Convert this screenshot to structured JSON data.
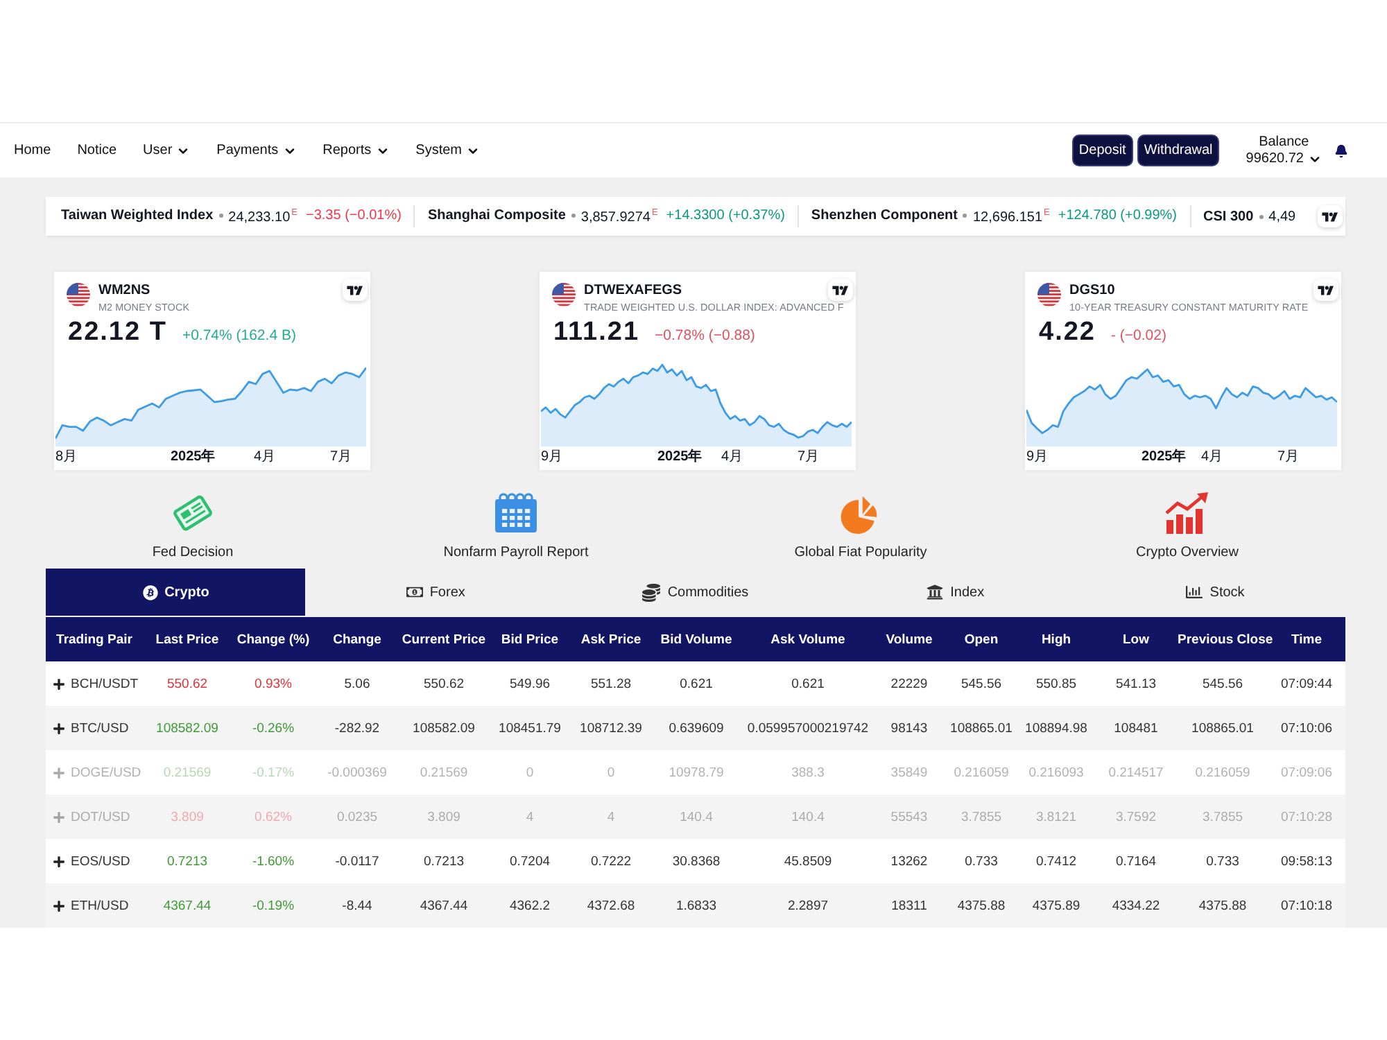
{
  "nav": {
    "items": [
      {
        "label": "Home",
        "dropdown": false
      },
      {
        "label": "Notice",
        "dropdown": false
      },
      {
        "label": "User",
        "dropdown": true
      },
      {
        "label": "Payments",
        "dropdown": true
      },
      {
        "label": "Reports",
        "dropdown": true
      },
      {
        "label": "System",
        "dropdown": true
      }
    ],
    "buttons": [
      "Deposit",
      "Withdrawal"
    ],
    "balance": {
      "label": "Balance",
      "value": "99620.72"
    }
  },
  "ticker": {
    "items": [
      {
        "name": "Taiwan Weighted Index",
        "price": "24,233.10$^{E}$",
        "change": "−3.35 (−0.01%)",
        "rising": false
      },
      {
        "name": "Shanghai Composite",
        "price": "3,857.9274$^{E}$",
        "change": "+14.3300 (+0.37%)",
        "rising": true
      },
      {
        "name": "Shenzhen Component",
        "price": "12,696.151$^{E}$",
        "change": "+124.780 (+0.99%)",
        "rising": true
      },
      {
        "name": "CSI 300",
        "price": "4,49"
      }
    ]
  },
  "mini_charts": [
    {
      "symbol": "WM2NS",
      "description": "M2 MONEY STOCK",
      "value": "22.12 T",
      "change": "+0.74% (162.4 B)",
      "rising": true,
      "axis_labels": [
        {
          "label": "8月",
          "kind": "month"
        },
        {
          "label": "2025年",
          "kind": "year"
        },
        {
          "label": "4月",
          "kind": "month"
        },
        {
          "label": "7月",
          "kind": "month"
        }
      ]
    },
    {
      "symbol": "DTWEXAFEGS",
      "description": "TRADE WEIGHTED U.S. DOLLAR INDEX: ADVANCED F",
      "value": "111.21",
      "change": "−0.78% (−0.88)",
      "rising": false,
      "axis_labels": [
        {
          "label": "9月",
          "kind": "month"
        },
        {
          "label": "2025年",
          "kind": "year"
        },
        {
          "label": "4月",
          "kind": "month"
        },
        {
          "label": "7月",
          "kind": "month"
        }
      ]
    },
    {
      "symbol": "DGS10",
      "description": "10-YEAR TREASURY CONSTANT MATURITY RATE",
      "value": "4.22",
      "change": "- (−0.02)",
      "rising": false,
      "axis_labels": [
        {
          "label": "9月",
          "kind": "month"
        },
        {
          "label": "2025年",
          "kind": "year"
        },
        {
          "label": "4月",
          "kind": "month"
        },
        {
          "label": "7月",
          "kind": "month"
        }
      ]
    }
  ],
  "shortcuts": [
    {
      "label": "Fed Decision",
      "kind": "newspaper"
    },
    {
      "label": "Nonfarm Payroll Report",
      "kind": "calendar"
    },
    {
      "label": "Global Fiat Popularity",
      "kind": "pie"
    },
    {
      "label": "Crypto Overview",
      "kind": "growth"
    }
  ],
  "tabs": [
    {
      "label": "Crypto",
      "kind": "bitcoin",
      "selected": true
    },
    {
      "label": "Forex",
      "kind": "banknote",
      "selected": false
    },
    {
      "label": "Commodities",
      "kind": "coins",
      "selected": false
    },
    {
      "label": "Index",
      "kind": "bank",
      "selected": false
    },
    {
      "label": "Stock",
      "kind": "bars",
      "selected": false
    }
  ],
  "table": {
    "columns": [
      "Trading Pair",
      "Last Price",
      "Change (%)",
      "Change",
      "Current Price",
      "Bid Price",
      "Ask Price",
      "Bid Volume",
      "Ask Volume",
      "Volume",
      "Open",
      "High",
      "Low",
      "Previous Close",
      "Time"
    ],
    "rows": [
      {
        "pair": "BCH/USDT",
        "rising": true,
        "inactive": false,
        "values": [
          "550.62",
          "0.93%",
          "5.06",
          "550.62",
          "549.96",
          "551.28",
          "0.621",
          "0.621",
          "22229",
          "545.56",
          "550.85",
          "541.13",
          "545.56",
          "07:09:44"
        ]
      },
      {
        "pair": "BTC/USD",
        "rising": false,
        "inactive": false,
        "values": [
          "108582.09",
          "-0.26%",
          "-282.92",
          "108582.09",
          "108451.79",
          "108712.39",
          "0.639609",
          "0.059957000219742",
          "98143",
          "108865.01",
          "108894.98",
          "108481",
          "108865.01",
          "07:10:06"
        ]
      },
      {
        "pair": "DOGE/USD",
        "rising": false,
        "inactive": true,
        "values": [
          "0.21569",
          "-0.17%",
          "-0.000369",
          "0.21569",
          "0",
          "0",
          "10978.79",
          "388.3",
          "35849",
          "0.216059",
          "0.216093",
          "0.214517",
          "0.216059",
          "07:09:06"
        ]
      },
      {
        "pair": "DOT/USD",
        "rising": true,
        "inactive": true,
        "values": [
          "3.809",
          "0.62%",
          "0.0235",
          "3.809",
          "4",
          "4",
          "140.4",
          "140.4",
          "55543",
          "3.7855",
          "3.8121",
          "3.7592",
          "3.7855",
          "07:10:28"
        ]
      },
      {
        "pair": "EOS/USD",
        "rising": false,
        "inactive": false,
        "values": [
          "0.7213",
          "-1.60%",
          "-0.0117",
          "0.7213",
          "0.7204",
          "0.7222",
          "30.8368",
          "45.8509",
          "13262",
          "0.733",
          "0.7412",
          "0.7164",
          "0.733",
          "09:58:13"
        ]
      },
      {
        "pair": "ETH/USD",
        "rising": false,
        "inactive": false,
        "values": [
          "4367.44",
          "-0.19%",
          "-8.44",
          "4367.44",
          "4362.2",
          "4372.68",
          "1.6833",
          "2.2897",
          "18311",
          "4375.88",
          "4375.89",
          "4334.22",
          "4375.88",
          "07:10:18"
        ]
      }
    ]
  }
}
